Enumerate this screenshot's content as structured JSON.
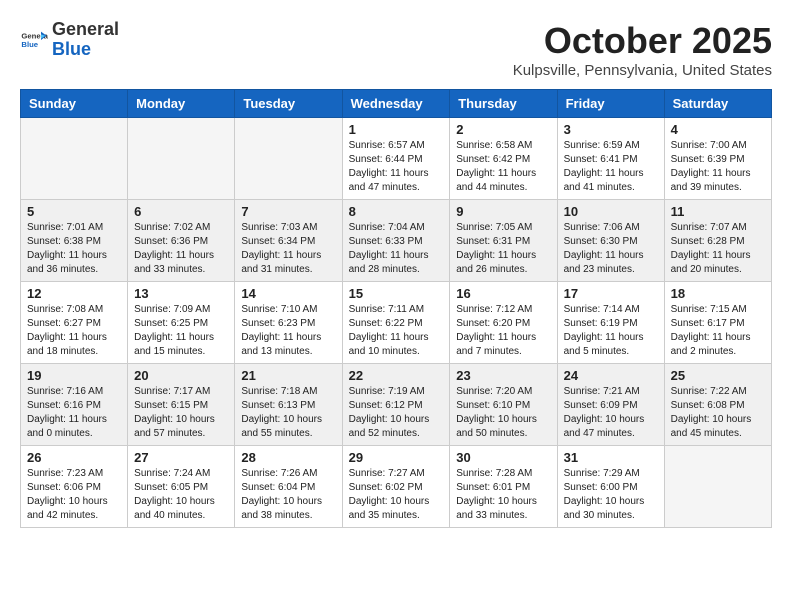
{
  "header": {
    "logo_general": "General",
    "logo_blue": "Blue",
    "month_title": "October 2025",
    "location": "Kulpsville, Pennsylvania, United States"
  },
  "weekdays": [
    "Sunday",
    "Monday",
    "Tuesday",
    "Wednesday",
    "Thursday",
    "Friday",
    "Saturday"
  ],
  "weeks": [
    [
      {
        "day": "",
        "info": ""
      },
      {
        "day": "",
        "info": ""
      },
      {
        "day": "",
        "info": ""
      },
      {
        "day": "1",
        "info": "Sunrise: 6:57 AM\nSunset: 6:44 PM\nDaylight: 11 hours\nand 47 minutes."
      },
      {
        "day": "2",
        "info": "Sunrise: 6:58 AM\nSunset: 6:42 PM\nDaylight: 11 hours\nand 44 minutes."
      },
      {
        "day": "3",
        "info": "Sunrise: 6:59 AM\nSunset: 6:41 PM\nDaylight: 11 hours\nand 41 minutes."
      },
      {
        "day": "4",
        "info": "Sunrise: 7:00 AM\nSunset: 6:39 PM\nDaylight: 11 hours\nand 39 minutes."
      }
    ],
    [
      {
        "day": "5",
        "info": "Sunrise: 7:01 AM\nSunset: 6:38 PM\nDaylight: 11 hours\nand 36 minutes."
      },
      {
        "day": "6",
        "info": "Sunrise: 7:02 AM\nSunset: 6:36 PM\nDaylight: 11 hours\nand 33 minutes."
      },
      {
        "day": "7",
        "info": "Sunrise: 7:03 AM\nSunset: 6:34 PM\nDaylight: 11 hours\nand 31 minutes."
      },
      {
        "day": "8",
        "info": "Sunrise: 7:04 AM\nSunset: 6:33 PM\nDaylight: 11 hours\nand 28 minutes."
      },
      {
        "day": "9",
        "info": "Sunrise: 7:05 AM\nSunset: 6:31 PM\nDaylight: 11 hours\nand 26 minutes."
      },
      {
        "day": "10",
        "info": "Sunrise: 7:06 AM\nSunset: 6:30 PM\nDaylight: 11 hours\nand 23 minutes."
      },
      {
        "day": "11",
        "info": "Sunrise: 7:07 AM\nSunset: 6:28 PM\nDaylight: 11 hours\nand 20 minutes."
      }
    ],
    [
      {
        "day": "12",
        "info": "Sunrise: 7:08 AM\nSunset: 6:27 PM\nDaylight: 11 hours\nand 18 minutes."
      },
      {
        "day": "13",
        "info": "Sunrise: 7:09 AM\nSunset: 6:25 PM\nDaylight: 11 hours\nand 15 minutes."
      },
      {
        "day": "14",
        "info": "Sunrise: 7:10 AM\nSunset: 6:23 PM\nDaylight: 11 hours\nand 13 minutes."
      },
      {
        "day": "15",
        "info": "Sunrise: 7:11 AM\nSunset: 6:22 PM\nDaylight: 11 hours\nand 10 minutes."
      },
      {
        "day": "16",
        "info": "Sunrise: 7:12 AM\nSunset: 6:20 PM\nDaylight: 11 hours\nand 7 minutes."
      },
      {
        "day": "17",
        "info": "Sunrise: 7:14 AM\nSunset: 6:19 PM\nDaylight: 11 hours\nand 5 minutes."
      },
      {
        "day": "18",
        "info": "Sunrise: 7:15 AM\nSunset: 6:17 PM\nDaylight: 11 hours\nand 2 minutes."
      }
    ],
    [
      {
        "day": "19",
        "info": "Sunrise: 7:16 AM\nSunset: 6:16 PM\nDaylight: 11 hours\nand 0 minutes."
      },
      {
        "day": "20",
        "info": "Sunrise: 7:17 AM\nSunset: 6:15 PM\nDaylight: 10 hours\nand 57 minutes."
      },
      {
        "day": "21",
        "info": "Sunrise: 7:18 AM\nSunset: 6:13 PM\nDaylight: 10 hours\nand 55 minutes."
      },
      {
        "day": "22",
        "info": "Sunrise: 7:19 AM\nSunset: 6:12 PM\nDaylight: 10 hours\nand 52 minutes."
      },
      {
        "day": "23",
        "info": "Sunrise: 7:20 AM\nSunset: 6:10 PM\nDaylight: 10 hours\nand 50 minutes."
      },
      {
        "day": "24",
        "info": "Sunrise: 7:21 AM\nSunset: 6:09 PM\nDaylight: 10 hours\nand 47 minutes."
      },
      {
        "day": "25",
        "info": "Sunrise: 7:22 AM\nSunset: 6:08 PM\nDaylight: 10 hours\nand 45 minutes."
      }
    ],
    [
      {
        "day": "26",
        "info": "Sunrise: 7:23 AM\nSunset: 6:06 PM\nDaylight: 10 hours\nand 42 minutes."
      },
      {
        "day": "27",
        "info": "Sunrise: 7:24 AM\nSunset: 6:05 PM\nDaylight: 10 hours\nand 40 minutes."
      },
      {
        "day": "28",
        "info": "Sunrise: 7:26 AM\nSunset: 6:04 PM\nDaylight: 10 hours\nand 38 minutes."
      },
      {
        "day": "29",
        "info": "Sunrise: 7:27 AM\nSunset: 6:02 PM\nDaylight: 10 hours\nand 35 minutes."
      },
      {
        "day": "30",
        "info": "Sunrise: 7:28 AM\nSunset: 6:01 PM\nDaylight: 10 hours\nand 33 minutes."
      },
      {
        "day": "31",
        "info": "Sunrise: 7:29 AM\nSunset: 6:00 PM\nDaylight: 10 hours\nand 30 minutes."
      },
      {
        "day": "",
        "info": ""
      }
    ]
  ]
}
